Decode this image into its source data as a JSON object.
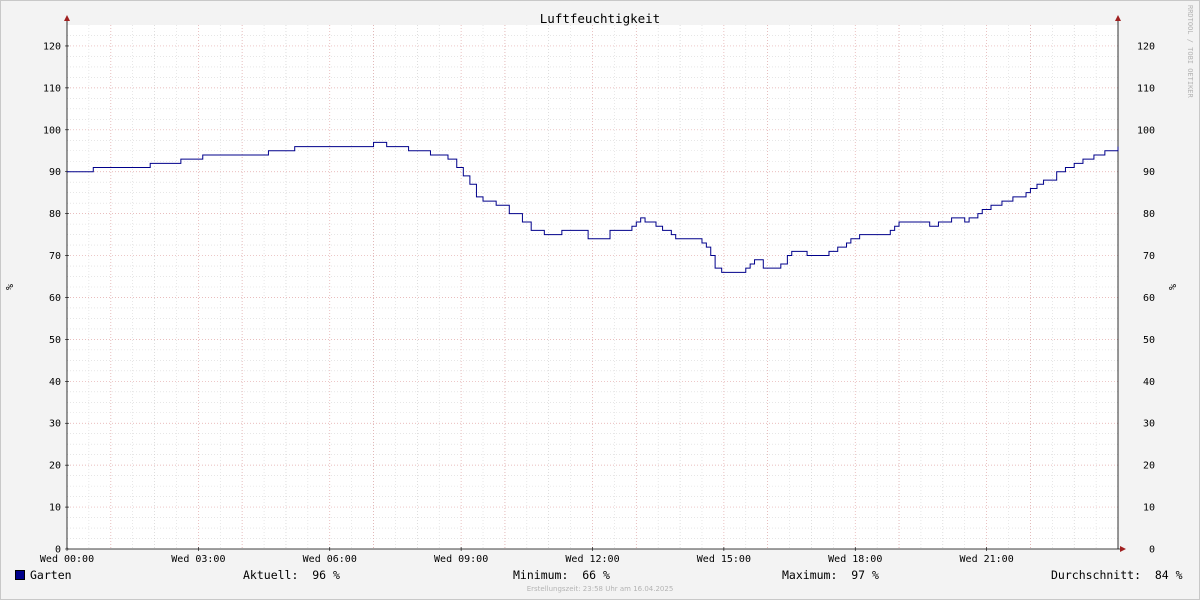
{
  "chart_data": {
    "type": "line",
    "title": "Luftfeuchtigkeit",
    "ylabel": "%",
    "ylim": [
      0,
      125
    ],
    "ytick_step": 10,
    "x_tick_labels": [
      "Wed 00:00",
      "Wed 03:00",
      "Wed 06:00",
      "Wed 09:00",
      "Wed 12:00",
      "Wed 15:00",
      "Wed 18:00",
      "Wed 21:00"
    ],
    "xlim_hours": [
      0,
      24
    ],
    "grid": true,
    "series": [
      {
        "name": "Garten",
        "color": "#00008b",
        "x_hours": [
          0,
          0.6,
          1.9,
          2.6,
          3.1,
          4.6,
          5.2,
          7.0,
          7.3,
          7.8,
          8.3,
          8.7,
          8.9,
          9.05,
          9.2,
          9.35,
          9.5,
          9.8,
          10.1,
          10.4,
          10.6,
          10.9,
          11.3,
          11.9,
          12.4,
          12.9,
          13.0,
          13.1,
          13.2,
          13.45,
          13.6,
          13.8,
          13.9,
          14.3,
          14.5,
          14.6,
          14.7,
          14.8,
          14.95,
          15.5,
          15.6,
          15.7,
          15.9,
          16.3,
          16.45,
          16.55,
          16.7,
          16.9,
          17.4,
          17.6,
          17.8,
          17.9,
          18.1,
          18.8,
          18.9,
          19.0,
          19.7,
          19.9,
          20.2,
          20.5,
          20.6,
          20.8,
          20.9,
          21.1,
          21.35,
          21.6,
          21.9,
          22.0,
          22.15,
          22.3,
          22.6,
          22.8,
          23.0,
          23.2,
          23.45,
          23.7,
          24.0
        ],
        "values": [
          90,
          91,
          92,
          93,
          94,
          95,
          96,
          97,
          96,
          95,
          94,
          93,
          91,
          89,
          87,
          84,
          83,
          82,
          80,
          78,
          76,
          75,
          76,
          74,
          76,
          77,
          78,
          79,
          78,
          77,
          76,
          75,
          74,
          74,
          73,
          72,
          70,
          67,
          66,
          67,
          68,
          69,
          67,
          68,
          70,
          71,
          71,
          70,
          71,
          72,
          73,
          74,
          75,
          76,
          77,
          78,
          77,
          78,
          79,
          78,
          79,
          80,
          81,
          82,
          83,
          84,
          85,
          86,
          87,
          88,
          90,
          91,
          92,
          93,
          94,
          95,
          96
        ]
      }
    ]
  },
  "legend": {
    "series_name": "Garten",
    "aktuell": "Aktuell:  96 %",
    "minimum": "Minimum:  66 %",
    "maximum": "Maximum:  97 %",
    "durchschnitt": "Durchschnitt:  84 %"
  },
  "footer": "Erstellungszeit: 23:58 Uhr am 16.04.2025",
  "watermark": "RRDTOOL / TOBI OETIKER"
}
